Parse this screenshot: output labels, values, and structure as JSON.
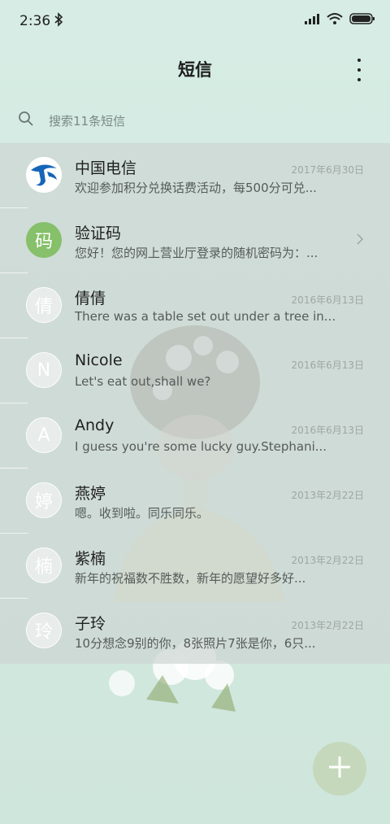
{
  "status_bar": {
    "time": "2:36"
  },
  "header": {
    "title": "短信"
  },
  "search": {
    "placeholder": "搜索11条短信"
  },
  "conversations": [
    {
      "name": "中国电信",
      "date": "2017年6月30日",
      "preview": "欢迎参加积分兑换话费活动，每500分可兑...",
      "avatar": ""
    },
    {
      "name": "验证码",
      "date": "",
      "preview": "您好！您的网上营业厅登录的随机密码为：...",
      "avatar": "码"
    },
    {
      "name": "倩倩",
      "date": "2016年6月13日",
      "preview": "There was a table set out under a tree in...",
      "avatar": "倩"
    },
    {
      "name": "Nicole",
      "date": "2016年6月13日",
      "preview": "Let's eat out,shall we?",
      "avatar": "N"
    },
    {
      "name": "Andy",
      "date": "2016年6月13日",
      "preview": "I guess you're some lucky guy.Stephani...",
      "avatar": "A"
    },
    {
      "name": "燕婷",
      "date": "2013年2月22日",
      "preview": "嗯。收到啦。同乐同乐。",
      "avatar": "婷"
    },
    {
      "name": "紫楠",
      "date": "2013年2月22日",
      "preview": "新年的祝福数不胜数，新年的愿望好多好...",
      "avatar": "楠"
    },
    {
      "name": "子玲",
      "date": "2013年2月22日",
      "preview": "10分想念9别的你，8张照片7张是你，6只...",
      "avatar": "玲"
    }
  ]
}
